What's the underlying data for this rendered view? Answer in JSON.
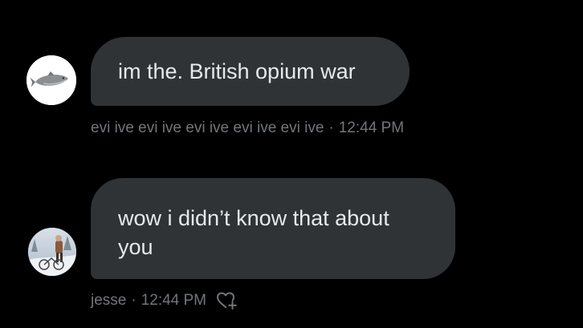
{
  "conversation": {
    "messages": [
      {
        "avatar_icon": "fish-icon",
        "text": "im the. British opium war",
        "sender": "evi ive evi ive evi ive evi ive evi ive",
        "separator": "·",
        "time": "12:44 PM"
      },
      {
        "avatar_icon": "snow-photo-avatar",
        "text": "wow i didn’t know that about you",
        "sender": "jesse",
        "separator": "·",
        "time": "12:44 PM",
        "action_icon": "heart-plus-icon"
      }
    ]
  },
  "colors": {
    "background": "#000000",
    "bubble": "#2f3336",
    "text": "#e7e9ea",
    "meta": "#71767b"
  }
}
